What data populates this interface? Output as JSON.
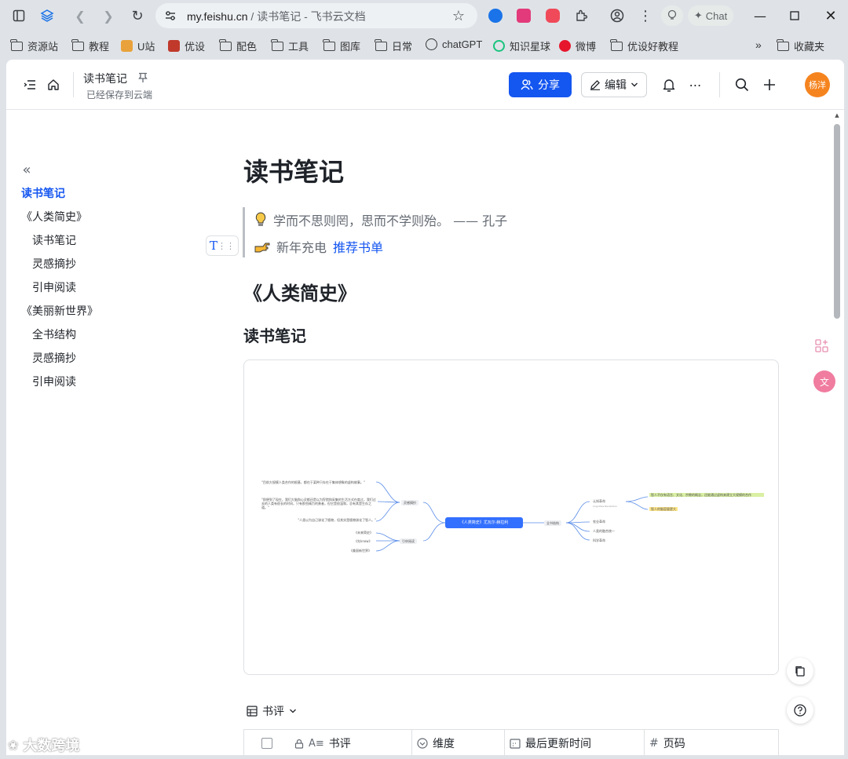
{
  "browser": {
    "url_host": "my.feishu.cn",
    "url_rest": " / 读书笔记 - 飞书云文档",
    "chat_label": "Chat"
  },
  "bookmarks": [
    "资源站",
    "教程",
    "U站",
    "优设",
    "配色",
    "工具",
    "图库",
    "日常",
    "chatGPT",
    "知识星球",
    "微博",
    "优设好教程"
  ],
  "bookmarks_folder": "收藏夹",
  "header": {
    "title": "读书笔记",
    "saved_status": "已经保存到云端",
    "share_label": "分享",
    "edit_label": "编辑",
    "avatar_text": "杨洋"
  },
  "outline": [
    {
      "label": "读书笔记",
      "level": 0,
      "active": true
    },
    {
      "label": "《人类简史》",
      "level": 0
    },
    {
      "label": "读书笔记",
      "level": 1
    },
    {
      "label": "灵感摘抄",
      "level": 1
    },
    {
      "label": "引申阅读",
      "level": 1
    },
    {
      "label": "《美丽新世界》",
      "level": 0
    },
    {
      "label": "全书结构",
      "level": 1
    },
    {
      "label": "灵感摘抄",
      "level": 1
    },
    {
      "label": "引申阅读",
      "level": 1
    }
  ],
  "doc": {
    "h1": "读书笔记",
    "quote1": "学而不思则罔，思而不学则殆。  —— 孔子",
    "quote2_prefix": "新年充电",
    "quote2_link": "推荐书单",
    "h2": "《人类简史》",
    "h3": "读书笔记"
  },
  "mindmap": {
    "root": "《人类简史》尤瓦尔·赫拉利",
    "left_branches": [
      "灵感摘抄",
      "引申阅读"
    ],
    "left_quotes": [
      "\"目前大规模人类合作的根基，都在于某种只存在于集体想象的虚构故事。\"",
      "\"即便到了现在，我们大脑和心灵都还是以为狩猎和采集的生活方式在度过，我们过去的人类有很长的时间，只有那些精力的勇者，但它是很温和，总有其是生存之道。\"",
      "\"人类以为自己驯化了植物，但其实是植物驯化了智人。\""
    ],
    "left_books": [
      "《未来简史》",
      "《先know》",
      "《美丽新世界》"
    ],
    "right_branch": "全书结构",
    "right_items": [
      "认知革命",
      "农业革命",
      "人类的融合统一",
      "科学革命"
    ],
    "right_sub": "Cognitive Revolution",
    "right_notes": [
      "智人不仅有语言、文化、宗教的概念，还能通过虚构来建立大规模的合作",
      "智人的脑容量更大"
    ]
  },
  "bitable": {
    "title": "书评",
    "columns": [
      "书评",
      "维度",
      "最后更新时间",
      "页码"
    ]
  },
  "watermark": "大数跨境"
}
